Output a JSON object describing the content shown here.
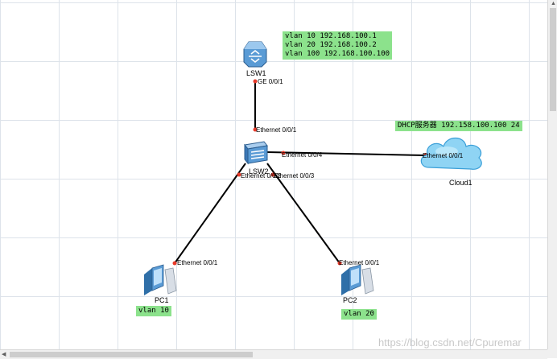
{
  "devices": {
    "lsw1": {
      "name": "LSW1"
    },
    "lsw2": {
      "name": "LSW2"
    },
    "pc1": {
      "name": "PC1"
    },
    "pc2": {
      "name": "PC2"
    },
    "cloud1": {
      "name": "Cloud1"
    }
  },
  "ports": {
    "lsw1_ge": "GE 0/0/1",
    "lsw2_e1": "Ethernet 0/0/1",
    "lsw2_e4": "Ethernet 0/0/4",
    "lsw2_e2": "Ethernet 0/0/2",
    "lsw2_e3": "Ethernet 0/0/3",
    "cloud_e1": "Ethernet 0/0/1",
    "pc1_e1": "Ethernet 0/0/1",
    "pc2_e1": "Ethernet 0/0/1"
  },
  "notes": {
    "lsw1_vlans": [
      "vlan 10 192.168.100.1",
      "vlan 20 192.168.100.2",
      "vlan 100 192.168.100.100"
    ],
    "dhcp": "DHCP服务器 192.158.100.100 24",
    "pc1_vlan": "vlan 10",
    "pc2_vlan": "vlan 20"
  },
  "watermark": "https://blog.csdn.net/Cpuremar",
  "colors": {
    "note_bg": "#8ce28c",
    "port_dot": "#e83a2a",
    "link": "#000000",
    "grid": "#dde3ea"
  }
}
